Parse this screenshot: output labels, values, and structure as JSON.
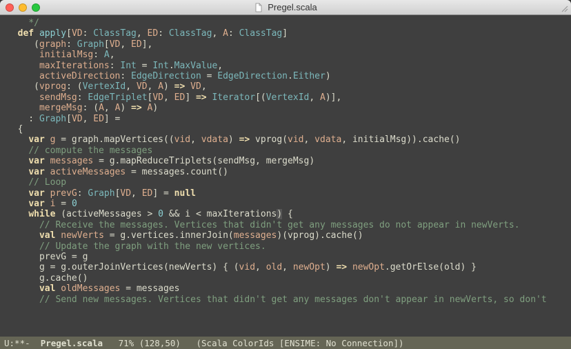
{
  "window": {
    "title": "Pregel.scala"
  },
  "code": {
    "lines": [
      [
        [
          "    ",
          "d"
        ],
        [
          "*/",
          "c"
        ]
      ],
      [
        [
          "  ",
          "d"
        ],
        [
          "def",
          "kw"
        ],
        [
          " ",
          "d"
        ],
        [
          "apply",
          "fn"
        ],
        [
          "[",
          "d"
        ],
        [
          "VD",
          "v"
        ],
        [
          ": ",
          "d"
        ],
        [
          "ClassTag",
          "t"
        ],
        [
          ", ",
          "d"
        ],
        [
          "ED",
          "v"
        ],
        [
          ": ",
          "d"
        ],
        [
          "ClassTag",
          "t"
        ],
        [
          ", ",
          "d"
        ],
        [
          "A",
          "v"
        ],
        [
          ": ",
          "d"
        ],
        [
          "ClassTag",
          "t"
        ],
        [
          "]",
          "d"
        ]
      ],
      [
        [
          "     (",
          "d"
        ],
        [
          "graph",
          "v"
        ],
        [
          ": ",
          "d"
        ],
        [
          "Graph",
          "t"
        ],
        [
          "[",
          "d"
        ],
        [
          "VD",
          "v"
        ],
        [
          ", ",
          "d"
        ],
        [
          "ED",
          "v"
        ],
        [
          "],",
          "d"
        ]
      ],
      [
        [
          "      ",
          "d"
        ],
        [
          "initialMsg",
          "v"
        ],
        [
          ": ",
          "d"
        ],
        [
          "A",
          "t"
        ],
        [
          ",",
          "d"
        ]
      ],
      [
        [
          "      ",
          "d"
        ],
        [
          "maxIterations",
          "v"
        ],
        [
          ": ",
          "d"
        ],
        [
          "Int",
          "t"
        ],
        [
          " = ",
          "d"
        ],
        [
          "Int",
          "t"
        ],
        [
          ".",
          "d"
        ],
        [
          "MaxValue",
          "t"
        ],
        [
          ",",
          "d"
        ]
      ],
      [
        [
          "      ",
          "d"
        ],
        [
          "activeDirection",
          "v"
        ],
        [
          ": ",
          "d"
        ],
        [
          "EdgeDirection",
          "t"
        ],
        [
          " = ",
          "d"
        ],
        [
          "EdgeDirection",
          "t"
        ],
        [
          ".",
          "d"
        ],
        [
          "Either",
          "t"
        ],
        [
          ")",
          "d"
        ]
      ],
      [
        [
          "     (",
          "d"
        ],
        [
          "vprog",
          "v"
        ],
        [
          ": (",
          "d"
        ],
        [
          "VertexId",
          "t"
        ],
        [
          ", ",
          "d"
        ],
        [
          "VD",
          "v"
        ],
        [
          ", ",
          "d"
        ],
        [
          "A",
          "v"
        ],
        [
          ") ",
          "d"
        ],
        [
          "=>",
          "kw"
        ],
        [
          " ",
          "d"
        ],
        [
          "VD",
          "v"
        ],
        [
          ",",
          "d"
        ]
      ],
      [
        [
          "      ",
          "d"
        ],
        [
          "sendMsg",
          "v"
        ],
        [
          ": ",
          "d"
        ],
        [
          "EdgeTriplet",
          "t"
        ],
        [
          "[",
          "d"
        ],
        [
          "VD",
          "v"
        ],
        [
          ", ",
          "d"
        ],
        [
          "ED",
          "v"
        ],
        [
          "] ",
          "d"
        ],
        [
          "=>",
          "kw"
        ],
        [
          " ",
          "d"
        ],
        [
          "Iterator",
          "t"
        ],
        [
          "[(",
          "d"
        ],
        [
          "VertexId",
          "t"
        ],
        [
          ", ",
          "d"
        ],
        [
          "A",
          "v"
        ],
        [
          ")],",
          "d"
        ]
      ],
      [
        [
          "      ",
          "d"
        ],
        [
          "mergeMsg",
          "v"
        ],
        [
          ": (",
          "d"
        ],
        [
          "A",
          "v"
        ],
        [
          ", ",
          "d"
        ],
        [
          "A",
          "v"
        ],
        [
          ") ",
          "d"
        ],
        [
          "=>",
          "kw"
        ],
        [
          " ",
          "d"
        ],
        [
          "A",
          "v"
        ],
        [
          ")",
          "d"
        ]
      ],
      [
        [
          "    : ",
          "d"
        ],
        [
          "Graph",
          "t"
        ],
        [
          "[",
          "d"
        ],
        [
          "VD",
          "v"
        ],
        [
          ", ",
          "d"
        ],
        [
          "ED",
          "v"
        ],
        [
          "] =",
          "d"
        ]
      ],
      [
        [
          "  {",
          "d"
        ]
      ],
      [
        [
          "    ",
          "d"
        ],
        [
          "var",
          "kw"
        ],
        [
          " ",
          "d"
        ],
        [
          "g",
          "v"
        ],
        [
          " = graph.mapVertices((",
          "d"
        ],
        [
          "vid",
          "v"
        ],
        [
          ", ",
          "d"
        ],
        [
          "vdata",
          "v"
        ],
        [
          ") ",
          "d"
        ],
        [
          "=>",
          "kw"
        ],
        [
          " vprog(",
          "d"
        ],
        [
          "vid",
          "v"
        ],
        [
          ", ",
          "d"
        ],
        [
          "vdata",
          "v"
        ],
        [
          ", initialMsg)).cache()",
          "d"
        ]
      ],
      [
        [
          "    ",
          "d"
        ],
        [
          "// compute the messages",
          "c"
        ]
      ],
      [
        [
          "    ",
          "d"
        ],
        [
          "var",
          "kw"
        ],
        [
          " ",
          "d"
        ],
        [
          "messages",
          "v"
        ],
        [
          " = g.mapReduceTriplets(sendMsg, mergeMsg)",
          "d"
        ]
      ],
      [
        [
          "    ",
          "d"
        ],
        [
          "var",
          "kw"
        ],
        [
          " ",
          "d"
        ],
        [
          "activeMessages",
          "v"
        ],
        [
          " = messages.count()",
          "d"
        ]
      ],
      [
        [
          "    ",
          "d"
        ],
        [
          "// Loop",
          "c"
        ]
      ],
      [
        [
          "    ",
          "d"
        ],
        [
          "var",
          "kw"
        ],
        [
          " ",
          "d"
        ],
        [
          "prevG",
          "v"
        ],
        [
          ": ",
          "d"
        ],
        [
          "Graph",
          "t"
        ],
        [
          "[",
          "d"
        ],
        [
          "VD",
          "v"
        ],
        [
          ", ",
          "d"
        ],
        [
          "ED",
          "v"
        ],
        [
          "] = ",
          "d"
        ],
        [
          "null",
          "kw"
        ]
      ],
      [
        [
          "    ",
          "d"
        ],
        [
          "var",
          "kw"
        ],
        [
          " ",
          "d"
        ],
        [
          "i",
          "v"
        ],
        [
          " = ",
          "d"
        ],
        [
          "0",
          "n"
        ]
      ],
      [
        [
          "    ",
          "d"
        ],
        [
          "while",
          "kw"
        ],
        [
          " (activeMessages > ",
          "d"
        ],
        [
          "0",
          "n"
        ],
        [
          " && i < maxIterations",
          "d"
        ],
        [
          ") {",
          "cur"
        ]
      ],
      [
        [
          "      ",
          "d"
        ],
        [
          "// Receive the messages. Vertices that didn't get any messages do not appear in newVerts.",
          "c"
        ]
      ],
      [
        [
          "      ",
          "d"
        ],
        [
          "val",
          "kw"
        ],
        [
          " ",
          "d"
        ],
        [
          "newVerts",
          "v"
        ],
        [
          " = g.vertices.innerJoin(",
          "d"
        ],
        [
          "messages",
          "v"
        ],
        [
          ")(vprog).cache()",
          "d"
        ]
      ],
      [
        [
          "      ",
          "d"
        ],
        [
          "// Update the graph with the new vertices.",
          "c"
        ]
      ],
      [
        [
          "      prevG = g",
          "d"
        ]
      ],
      [
        [
          "      g = g.outerJoinVertices(newVerts) { (",
          "d"
        ],
        [
          "vid",
          "v"
        ],
        [
          ", ",
          "d"
        ],
        [
          "old",
          "v"
        ],
        [
          ", ",
          "d"
        ],
        [
          "newOpt",
          "v"
        ],
        [
          ") ",
          "d"
        ],
        [
          "=>",
          "kw"
        ],
        [
          " ",
          "d"
        ],
        [
          "newOpt",
          "v"
        ],
        [
          ".getOrElse(old) }",
          "d"
        ]
      ],
      [
        [
          "      g.cache()",
          "d"
        ]
      ],
      [
        [
          "",
          "d"
        ]
      ],
      [
        [
          "      ",
          "d"
        ],
        [
          "val",
          "kw"
        ],
        [
          " ",
          "d"
        ],
        [
          "oldMessages",
          "v"
        ],
        [
          " = messages",
          "d"
        ]
      ],
      [
        [
          "      ",
          "d"
        ],
        [
          "// Send new messages. Vertices that didn't get any messages don't appear in newVerts, so don't",
          "c"
        ]
      ]
    ]
  },
  "modeline": {
    "prefix": "U:**-",
    "filename": "Pregel.scala",
    "percent": "71%",
    "pos": "(128,50)",
    "mode": "(Scala ColorIds [ENSIME: No Connection])"
  }
}
